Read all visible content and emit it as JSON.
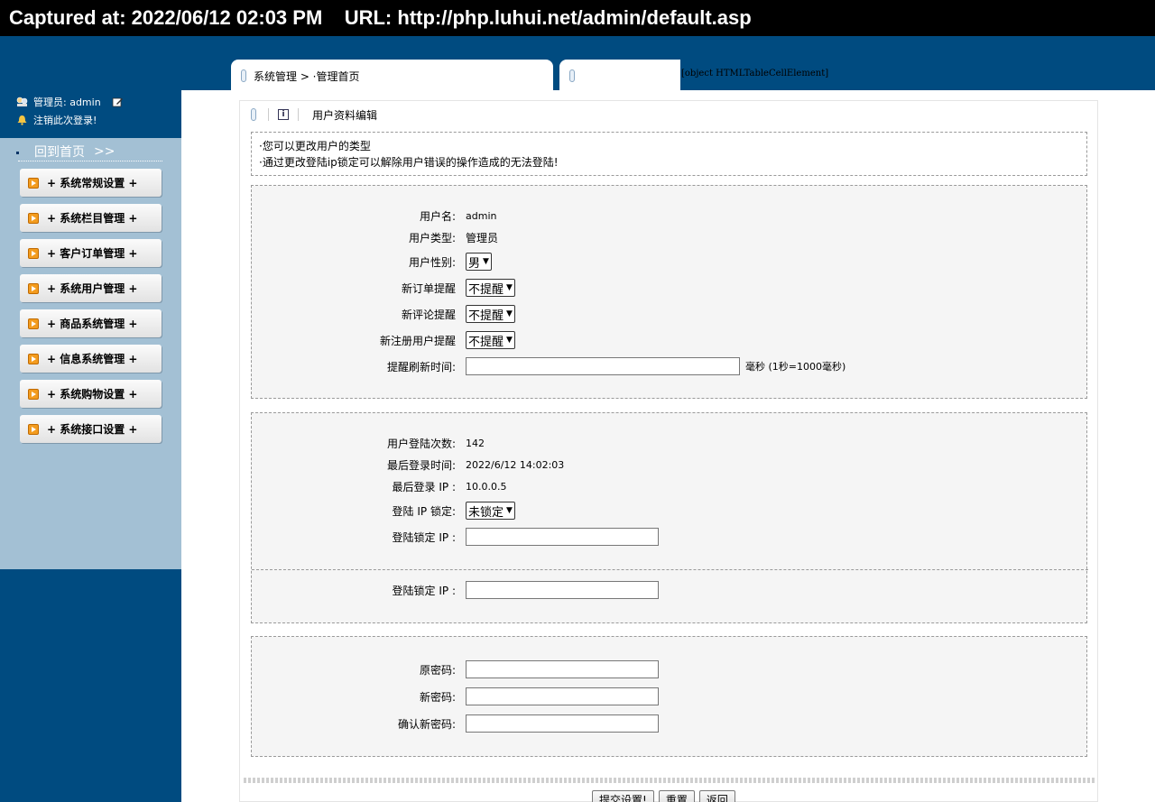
{
  "capture": {
    "text": "Captured at: 2022/06/12 02:03 PM    URL: http://php.luhui.net/admin/default.asp"
  },
  "tabs": {
    "tab1_label": "系统管理 > ·管理首页",
    "tab2_label": "[object HTMLTableCellElement]"
  },
  "user": {
    "admin_label": "管理员: admin",
    "logout_label": "注销此次登录!"
  },
  "sidebar": {
    "home_label": "回到首页",
    "home_arrows": ">>",
    "items": [
      {
        "label": "+ 系统常规设置 +"
      },
      {
        "label": "+ 系统栏目管理 +"
      },
      {
        "label": "+ 客户订单管理 +"
      },
      {
        "label": "+ 系统用户管理 +"
      },
      {
        "label": "+ 商品系统管理 +"
      },
      {
        "label": "+ 信息系统管理 +"
      },
      {
        "label": "+ 系统购物设置 +"
      },
      {
        "label": "+ 系统接口设置 +"
      }
    ]
  },
  "panel": {
    "title": "用户资料编辑",
    "notices": [
      "·您可以更改用户的类型",
      "·通过更改登陆ip锁定可以解除用户错误的操作造成的无法登陆!"
    ]
  },
  "profile": {
    "username_label": "用户名:",
    "username": "admin",
    "type_label": "用户类型:",
    "type": "管理员",
    "gender_label": "用户性别:",
    "gender": "男",
    "order_alert_label": "新订单提醒",
    "order_alert": "不提醒",
    "comment_alert_label": "新评论提醒",
    "comment_alert": "不提醒",
    "register_alert_label": "新注册用户提醒",
    "register_alert": "不提醒",
    "refresh_label": "提醒刷新时间:",
    "refresh_value": "",
    "refresh_unit": "毫秒 (1秒=1000毫秒)"
  },
  "login": {
    "count_label": "用户登陆次数:",
    "count": "142",
    "last_time_label": "最后登录时间:",
    "last_time": "2022/6/12 14:02:03",
    "last_ip_label": "最后登录 IP :",
    "last_ip": "10.0.0.5",
    "ip_lock_label": "登陆 IP 锁定:",
    "ip_lock": "未锁定",
    "lock_ip_label": "登陆锁定 IP :",
    "lock_ip_value": "",
    "lock_ip_label_2": "登陆锁定 IP :",
    "lock_ip_value_2": ""
  },
  "password": {
    "old_label": "原密码:",
    "new_label": "新密码:",
    "confirm_label": "确认新密码:"
  },
  "buttons": {
    "submit": "提交设置!",
    "reset": "重置",
    "back": "返回"
  }
}
